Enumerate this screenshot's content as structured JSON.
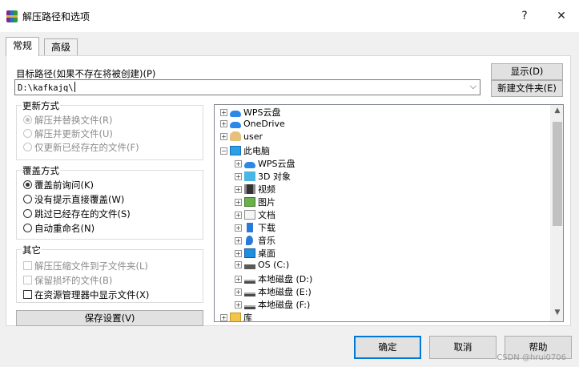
{
  "window": {
    "title": "解压路径和选项",
    "help_glyph": "?",
    "close_glyph": "✕"
  },
  "tabs": [
    {
      "label": "常规",
      "active": true
    },
    {
      "label": "高级",
      "active": false
    }
  ],
  "destination": {
    "label": "目标路径(如果不存在将被创建)(P)",
    "value": "D:\\kafkajq\\",
    "dropdown_glyph": "⌵"
  },
  "side_buttons": {
    "show": "显示(D)",
    "new_folder": "新建文件夹(E)"
  },
  "update_mode": {
    "title": "更新方式",
    "options": [
      {
        "label": "解压并替换文件(R)",
        "selected": true,
        "enabled": false
      },
      {
        "label": "解压并更新文件(U)",
        "selected": false,
        "enabled": false
      },
      {
        "label": "仅更新已经存在的文件(F)",
        "selected": false,
        "enabled": false
      }
    ]
  },
  "overwrite_mode": {
    "title": "覆盖方式",
    "options": [
      {
        "label": "覆盖前询问(K)",
        "selected": true,
        "enabled": true
      },
      {
        "label": "没有提示直接覆盖(W)",
        "selected": false,
        "enabled": true
      },
      {
        "label": "跳过已经存在的文件(S)",
        "selected": false,
        "enabled": true
      },
      {
        "label": "自动重命名(N)",
        "selected": false,
        "enabled": true
      }
    ]
  },
  "misc": {
    "title": "其它",
    "options": [
      {
        "label": "解压压缩文件到子文件夹(L)",
        "checked": false,
        "enabled": false
      },
      {
        "label": "保留损坏的文件(B)",
        "checked": false,
        "enabled": false
      },
      {
        "label": "在资源管理器中显示文件(X)",
        "checked": false,
        "enabled": true
      }
    ]
  },
  "save_settings": "保存设置(V)",
  "tree": {
    "items": [
      {
        "label": "WPS云盘",
        "icon": "cloud-icon",
        "level": 0,
        "expander": "+"
      },
      {
        "label": "OneDrive",
        "icon": "cloud-icon",
        "level": 0,
        "expander": "+"
      },
      {
        "label": "user",
        "icon": "user-icon",
        "level": 0,
        "expander": "+"
      },
      {
        "label": "此电脑",
        "icon": "computer-icon",
        "level": 0,
        "expander": "−"
      },
      {
        "label": "WPS云盘",
        "icon": "cloud-icon",
        "level": 1,
        "expander": "+"
      },
      {
        "label": "3D 对象",
        "icon": "3d-objects-icon",
        "level": 1,
        "expander": "+"
      },
      {
        "label": "视频",
        "icon": "video-icon",
        "level": 1,
        "expander": "+"
      },
      {
        "label": "图片",
        "icon": "pictures-icon",
        "level": 1,
        "expander": "+"
      },
      {
        "label": "文档",
        "icon": "documents-icon",
        "level": 1,
        "expander": "+"
      },
      {
        "label": "下载",
        "icon": "downloads-icon",
        "level": 1,
        "expander": "+"
      },
      {
        "label": "音乐",
        "icon": "music-icon",
        "level": 1,
        "expander": "+"
      },
      {
        "label": "桌面",
        "icon": "desktop-icon",
        "level": 1,
        "expander": "+"
      },
      {
        "label": "OS (C:)",
        "icon": "os-drive-icon",
        "level": 1,
        "expander": "+"
      },
      {
        "label": "本地磁盘 (D:)",
        "icon": "drive-icon",
        "level": 1,
        "expander": "+"
      },
      {
        "label": "本地磁盘 (E:)",
        "icon": "drive-icon",
        "level": 1,
        "expander": "+"
      },
      {
        "label": "本地磁盘 (F:)",
        "icon": "drive-icon",
        "level": 1,
        "expander": "+"
      },
      {
        "label": "库",
        "icon": "library-icon",
        "level": 0,
        "expander": "+"
      }
    ],
    "scroll_up": "▲",
    "scroll_down": "▼"
  },
  "footer": {
    "ok": "确定",
    "cancel": "取消",
    "help": "帮助"
  },
  "watermark": "CSDN @hrui0706",
  "colors": {
    "accent": "#0078d7",
    "dialog_bg": "#f0f0f0",
    "button_bg": "#e1e1e1"
  }
}
